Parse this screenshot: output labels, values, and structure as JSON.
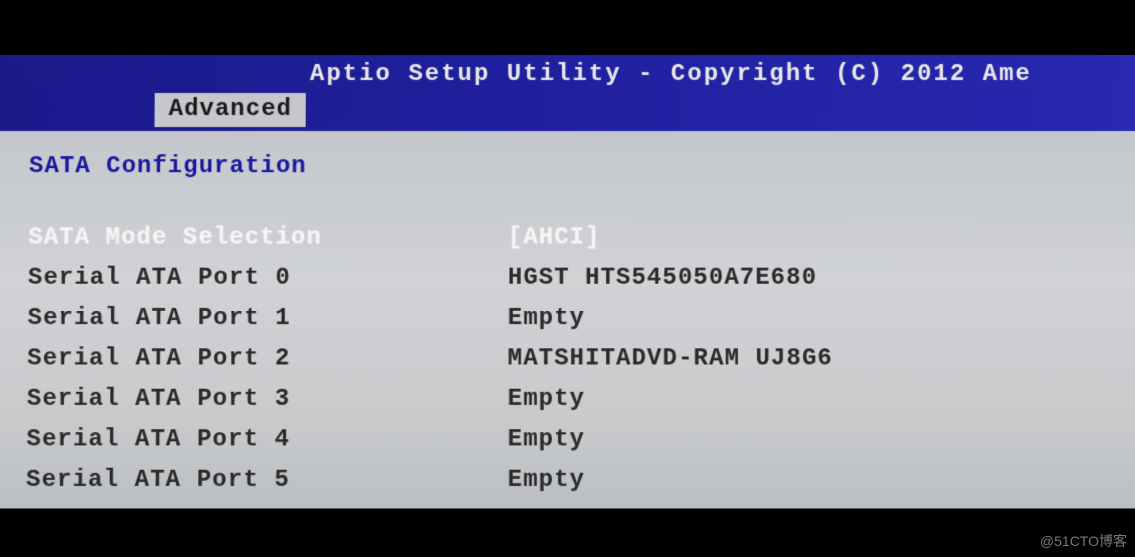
{
  "header": {
    "title": "Aptio Setup Utility - Copyright (C) 2012 Ame"
  },
  "tabs": {
    "active": "Advanced"
  },
  "section": {
    "title": "SATA Configuration"
  },
  "rows": [
    {
      "label": "SATA Mode Selection",
      "value": "[AHCI]",
      "selected": true
    },
    {
      "label": "Serial ATA Port 0",
      "value": "HGST HTS545050A7E680",
      "selected": false
    },
    {
      "label": "Serial ATA Port 1",
      "value": "Empty",
      "selected": false
    },
    {
      "label": "Serial ATA Port 2",
      "value": "MATSHITADVD-RAM UJ8G6",
      "selected": false
    },
    {
      "label": "Serial ATA Port 3",
      "value": "Empty",
      "selected": false
    },
    {
      "label": "Serial ATA Port 4",
      "value": "Empty",
      "selected": false
    },
    {
      "label": "Serial ATA Port 5",
      "value": "Empty",
      "selected": false
    }
  ],
  "watermark": "@51CTO博客"
}
